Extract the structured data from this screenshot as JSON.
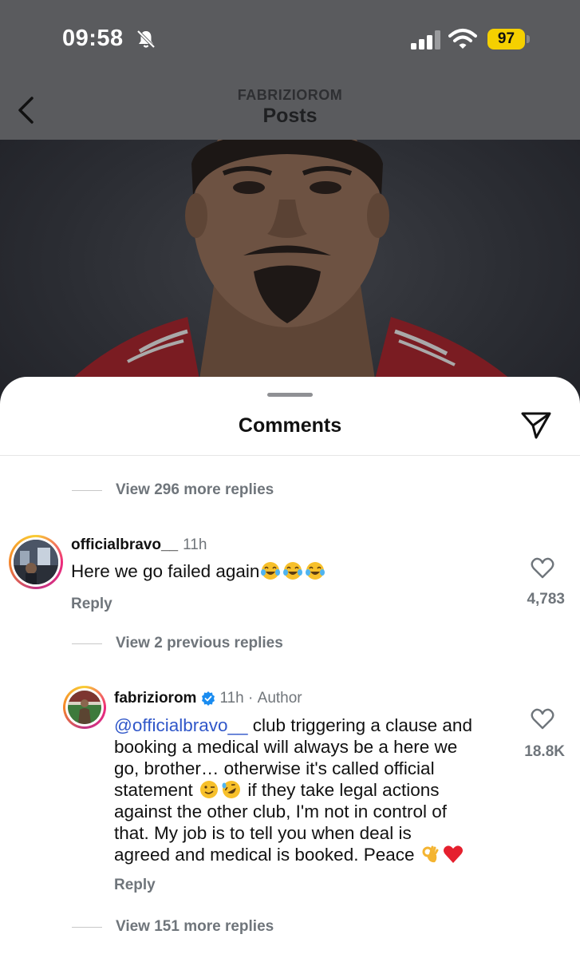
{
  "status_bar": {
    "time": "09:58",
    "battery": "97",
    "icons": [
      "bell-off-icon",
      "signal-icon",
      "wifi-icon",
      "battery-icon"
    ]
  },
  "header": {
    "subtitle": "FABRIZIOROM",
    "title": "Posts",
    "back_icon": "chevron-left-icon"
  },
  "sheet": {
    "title": "Comments",
    "share_icon": "paper-plane-icon"
  },
  "thread_top": {
    "view_more": "View 296 more replies"
  },
  "comment_1": {
    "username": "officialbravo__",
    "time": "11h",
    "text": "Here we go failed again",
    "emojis": [
      "tears-of-joy",
      "tears-of-joy",
      "tears-of-joy"
    ],
    "reply": "Reply",
    "likes": "4,783",
    "view_previous": "View 2 previous replies"
  },
  "comment_2": {
    "username": "fabriziorom",
    "verified": true,
    "time": "11h",
    "separator": " · ",
    "author": "Author",
    "mention": "@officialbravo__",
    "line1": " club triggering a clause and",
    "line2": "booking a medical will always be a here we",
    "line3": "go, brother… otherwise it's called official",
    "line4": "statement",
    "line4_emojis": [
      "winking-face",
      "rolling-laughing"
    ],
    "line4_rest": " if they take legal actions",
    "line5": "against the other club, I'm not in control of",
    "line6": "that. My job is to tell you when deal is",
    "line7": "agreed and medical is booked. Peace",
    "line7_emojis": [
      "ok-hand",
      "red-heart"
    ],
    "reply": "Reply",
    "likes": "18.8K",
    "view_more": "View 151 more replies"
  },
  "colors": {
    "mention": "#3057c9",
    "muted_text": "#6f757b",
    "battery": "#f5d000",
    "dim_overlay": "#5a5b5e"
  }
}
